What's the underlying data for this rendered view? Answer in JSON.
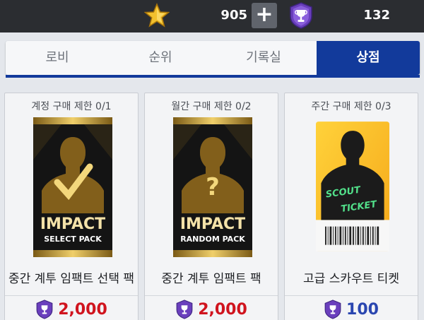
{
  "topbar": {
    "gold_icon": "star-icon",
    "gold_amount": "905",
    "add_label": "+",
    "trophy_icon": "trophy-icon",
    "trophy_amount": "132"
  },
  "tabs": [
    {
      "label": "로비"
    },
    {
      "label": "순위"
    },
    {
      "label": "기록실"
    },
    {
      "label": "상점",
      "active": true
    }
  ],
  "products": [
    {
      "limit": "계정 구매 제한 0/1",
      "art_title": "IMPACT",
      "art_subtitle": "SELECT PACK",
      "name": "중간 계투 임팩트 선택 팩",
      "price": "2,000",
      "price_color": "#d0141e"
    },
    {
      "limit": "월간 구매 제한 0/2",
      "art_title": "IMPACT",
      "art_subtitle": "RANDOM PACK",
      "name": "중간 계투 임팩트 팩",
      "price": "2,000",
      "price_color": "#d0141e"
    },
    {
      "limit": "주간 구매 제한 0/3",
      "art_title": "SCOUT",
      "art_subtitle": "TICKET",
      "name": "고급 스카우트 티켓",
      "price": "100",
      "price_color": "#2a46b0"
    }
  ],
  "colors": {
    "tab_active": "#123a9b",
    "topbar": "#2b2d31",
    "trophy": "#6a3fbd"
  }
}
